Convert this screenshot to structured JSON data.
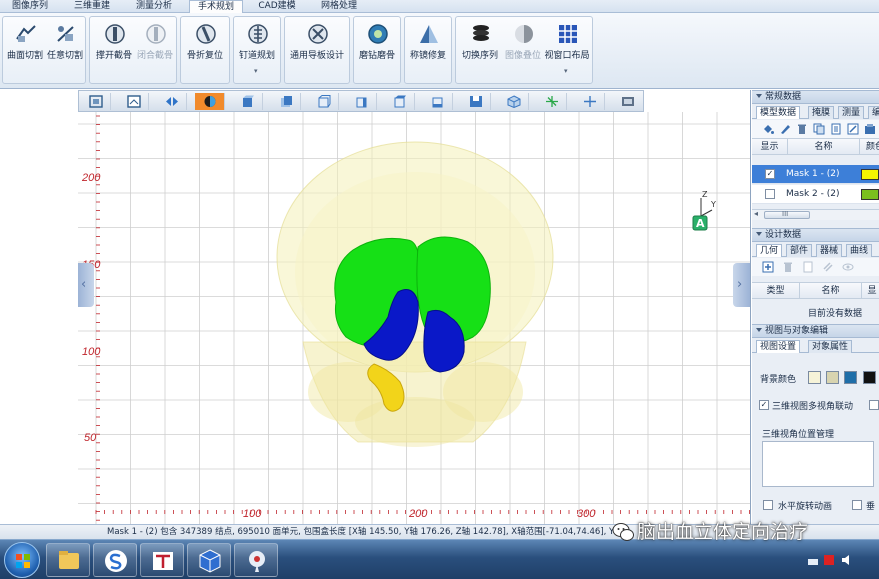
{
  "ribbon_tabs": [
    {
      "label": "图像序列"
    },
    {
      "label": "三维重建"
    },
    {
      "label": "测量分析"
    },
    {
      "label": "手术规划",
      "active": true
    },
    {
      "label": "CAD建模"
    },
    {
      "label": "网格处理"
    }
  ],
  "ribbon_buttons": [
    {
      "label": "曲面切割",
      "icon": "curved-cut-icon"
    },
    {
      "label": "任意切割",
      "icon": "free-cut-icon"
    },
    {
      "label": "撑开截骨",
      "icon": "osteotomy-open-icon"
    },
    {
      "label": "闭合截骨",
      "icon": "osteotomy-close-icon",
      "disabled": true
    },
    {
      "label": "骨折复位",
      "icon": "fracture-reduction-icon"
    },
    {
      "label": "钉道规划",
      "icon": "screw-path-icon",
      "dropdown": true
    },
    {
      "label": "通用导板设计",
      "icon": "guide-design-icon"
    },
    {
      "label": "磨钻磨骨",
      "icon": "burr-grinding-icon"
    },
    {
      "label": "称镜修复",
      "icon": "mirror-repair-icon"
    },
    {
      "label": "切换序列",
      "icon": "switch-sequence-icon"
    },
    {
      "label": "图像叠位",
      "icon": "image-overlay-icon",
      "disabled": true
    },
    {
      "label": "视窗口布局",
      "icon": "window-layout-icon",
      "dropdown": true
    }
  ],
  "view_toolbar": [
    {
      "icon": "fit-view-icon"
    },
    {
      "icon": "layout-view-icon"
    },
    {
      "icon": "sagittal-view-icon"
    },
    {
      "icon": "render-mode-icon",
      "active": true
    },
    {
      "icon": "front-view-icon"
    },
    {
      "icon": "back-view-icon"
    },
    {
      "icon": "left-view-icon"
    },
    {
      "icon": "right-view-icon"
    },
    {
      "icon": "top-view-icon"
    },
    {
      "icon": "bottom-view-icon"
    },
    {
      "icon": "snapshot-icon"
    },
    {
      "icon": "cube-view-icon"
    },
    {
      "icon": "axes-icon"
    },
    {
      "icon": "crosshair-icon"
    },
    {
      "icon": "film-icon"
    }
  ],
  "viewport": {
    "y_labels": [
      "200",
      "150",
      "100",
      "50"
    ],
    "x_labels": [
      "100",
      "200",
      "300"
    ],
    "gizmo": {
      "z": "Z",
      "y": "Y",
      "badge": "A"
    },
    "colors": {
      "green": "#16e016",
      "blue": "#0a18c8",
      "yellow": "#f2d41a",
      "skull": "#f4f1b8",
      "grid": "#cfcfcf",
      "axis_label": "#c0262d"
    }
  },
  "right_panel": {
    "common": {
      "title": "常规数据",
      "tabs": [
        "模型数据",
        "掩膜",
        "测量",
        "编"
      ],
      "headers": [
        "显示",
        "名称",
        "颜色"
      ],
      "rows": [
        {
          "checked": "✓",
          "name": "Mask 1 - (2)",
          "color": "#f5f500",
          "selected": true
        },
        {
          "checked": "",
          "name": "Mask 2 - (2)",
          "color": "#7ac01e",
          "selected": false
        }
      ],
      "scroll_label": "III"
    },
    "design": {
      "title": "设计数据",
      "tabs": [
        "几何",
        "部件",
        "器械",
        "曲线"
      ],
      "headers": [
        "类型",
        "名称",
        "显"
      ],
      "empty": "目前没有数据"
    },
    "view_edit": {
      "title": "视图与对象编辑",
      "tabs": [
        "视图设置",
        "对象属性"
      ],
      "bg_label": "背景颜色",
      "bg_colors": [
        "#f6f3d8",
        "#d8d4b0",
        "#1f6ea8",
        "#111111"
      ],
      "linkage_label": "三维视图多视角联动",
      "linkage_checked": "✓",
      "position_label": "三维视角位置管理",
      "rotate_label": "水平旋转动画",
      "extra_label": "垂"
    }
  },
  "statusbar": {
    "text": "Mask 1 - (2) 包含 347389 结点, 695010 面单元, 包围盒长度 [X轴 145.50, Y轴 176.26, Z轴 142.78], X轴范围[-71.04,74.46], Y"
  },
  "watermark": {
    "text": "脑出血立体定向治疗"
  }
}
